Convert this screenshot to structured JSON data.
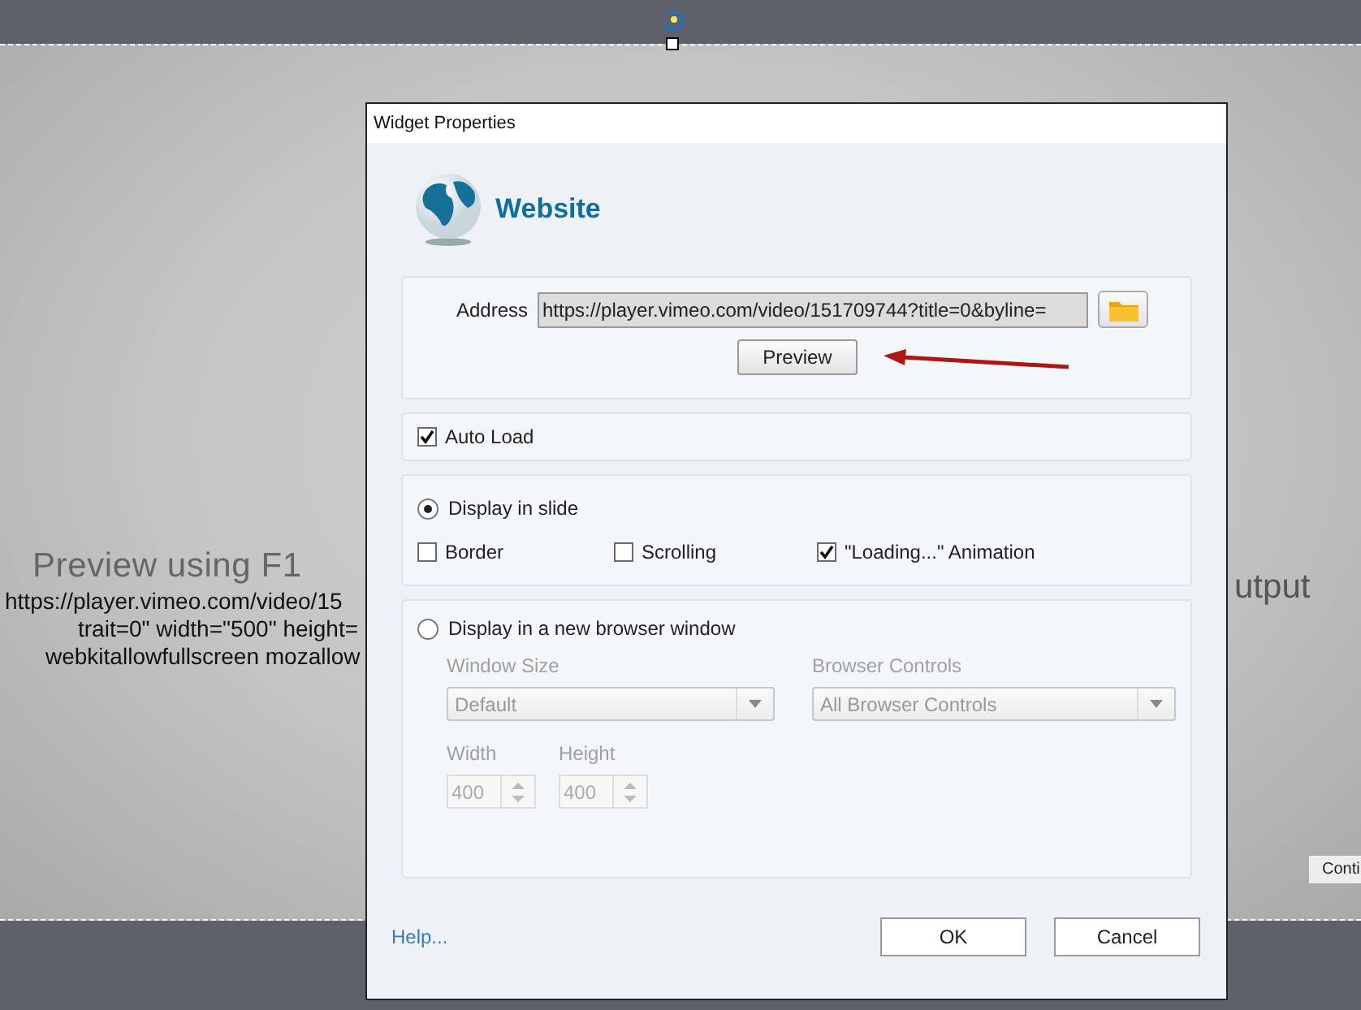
{
  "slide": {
    "subtitle_fragment": "Preview using F1",
    "code_lines": [
      "https://player.vimeo.com/video/15",
      "trait=0\" width=\"500\" height=",
      "webkitallowfullscreen mozallow"
    ],
    "right_fragment": "utput",
    "button_fragment": "Conti"
  },
  "dialog": {
    "title": "Widget Properties",
    "heading": "Website",
    "address": {
      "label": "Address",
      "value": "https://player.vimeo.com/video/151709744?title=0&byline="
    },
    "preview_button": "Preview",
    "auto_load": {
      "label": "Auto Load",
      "checked": true
    },
    "display_in_slide": {
      "label": "Display in slide",
      "selected": true
    },
    "slide_options": [
      {
        "label": "Border",
        "checked": false
      },
      {
        "label": "Scrolling",
        "checked": false
      },
      {
        "label": "\"Loading...\" Animation",
        "checked": true
      }
    ],
    "new_window": {
      "label": "Display in a new browser window",
      "selected": false,
      "disabled": true,
      "window_size": {
        "label": "Window Size",
        "value": "Default"
      },
      "browser_controls": {
        "label": "Browser Controls",
        "value": "All Browser Controls"
      },
      "width": {
        "label": "Width",
        "value": "400"
      },
      "height": {
        "label": "Height",
        "value": "400"
      }
    },
    "help_link": "Help...",
    "buttons": [
      "OK",
      "Cancel"
    ]
  }
}
